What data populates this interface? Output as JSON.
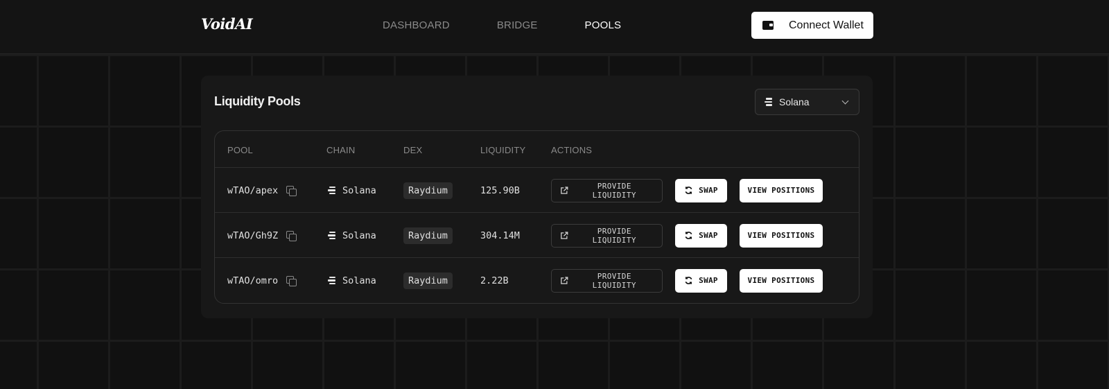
{
  "header": {
    "logo": "VoidAI",
    "nav": [
      {
        "label": "DASHBOARD",
        "active": false
      },
      {
        "label": "BRIDGE",
        "active": false
      },
      {
        "label": "POOLS",
        "active": true
      }
    ],
    "connect_wallet_label": "Connect Wallet",
    "wallet_icon": "wallet-icon"
  },
  "pools_card": {
    "title": "Liquidity Pools",
    "chain_select": {
      "value": "Solana",
      "icon": "solana-icon"
    },
    "columns": [
      "POOL",
      "CHAIN",
      "DEX",
      "LIQUIDITY",
      "ACTIONS"
    ],
    "rows": [
      {
        "pool": "wTAO/apex",
        "chain": "Solana",
        "dex": "Raydium",
        "liquidity": "125.90B",
        "actions": {
          "provide": "PROVIDE LIQUIDITY",
          "swap": "SWAP",
          "view": "VIEW POSITIONS"
        }
      },
      {
        "pool": "wTAO/Gh9Z",
        "chain": "Solana",
        "dex": "Raydium",
        "liquidity": "304.14M",
        "actions": {
          "provide": "PROVIDE LIQUIDITY",
          "swap": "SWAP",
          "view": "VIEW POSITIONS"
        }
      },
      {
        "pool": "wTAO/omro",
        "chain": "Solana",
        "dex": "Raydium",
        "liquidity": "2.22B",
        "actions": {
          "provide": "PROVIDE LIQUIDITY",
          "swap": "SWAP",
          "view": "VIEW POSITIONS"
        }
      }
    ]
  },
  "colors": {
    "background": "#101010",
    "card": "#181818",
    "accent": "#ffffff",
    "muted_text": "#8a8a8a"
  }
}
